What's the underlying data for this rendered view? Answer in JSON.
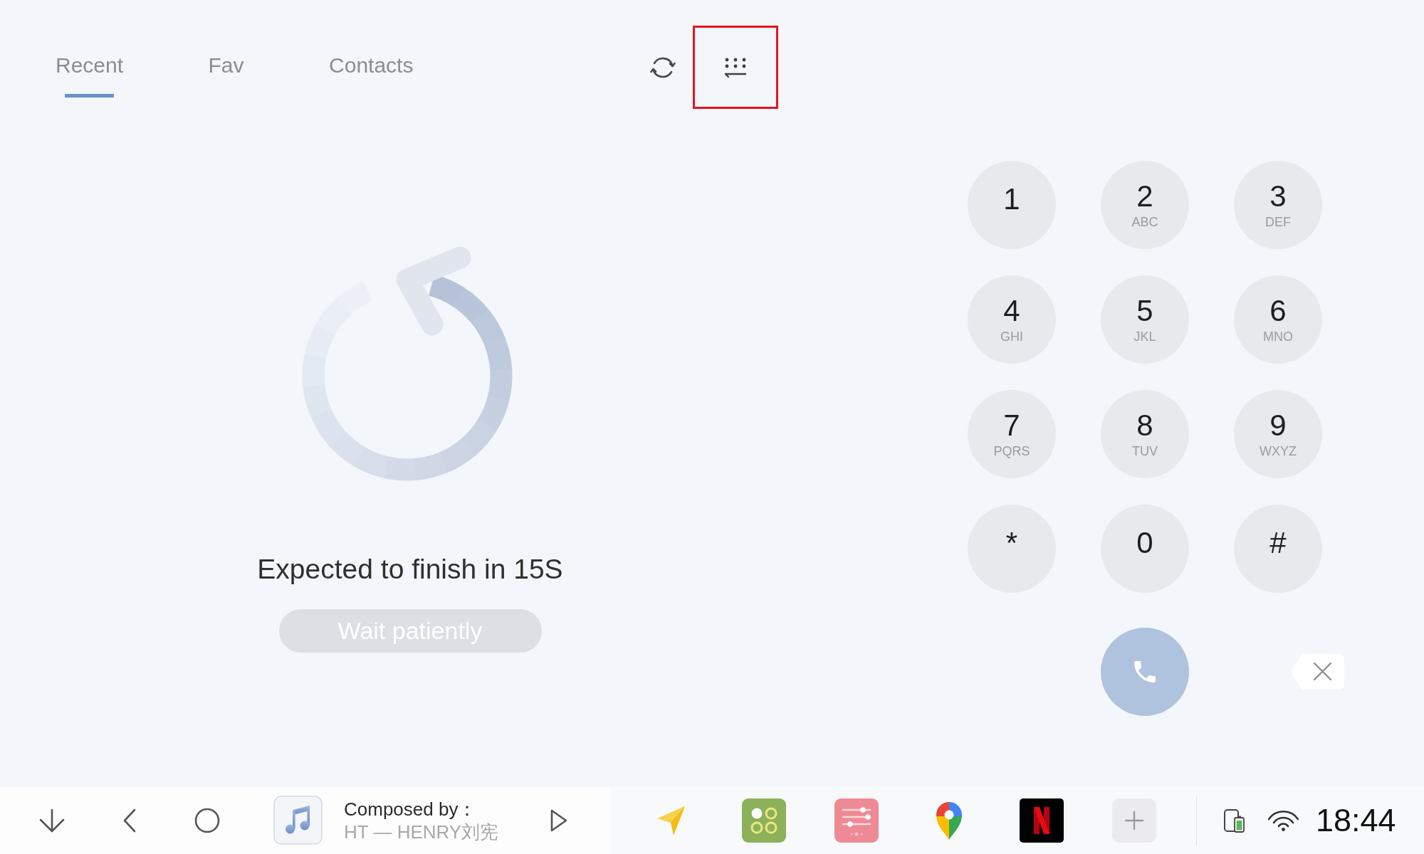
{
  "tabs": [
    {
      "label": "Recent",
      "selected": true
    },
    {
      "label": "Fav",
      "selected": false
    },
    {
      "label": "Contacts",
      "selected": false
    }
  ],
  "keypad_toggle": {
    "highlighted": true
  },
  "progress": {
    "message": "Expected to finish in 15S",
    "button": {
      "label": "Wait patiently",
      "disabled": true
    }
  },
  "dialpad": {
    "keys": [
      {
        "digit": "1"
      },
      {
        "digit": "2",
        "letters": "ABC"
      },
      {
        "digit": "3",
        "letters": "DEF"
      },
      {
        "digit": "4",
        "letters": "GHI"
      },
      {
        "digit": "5",
        "letters": "JKL"
      },
      {
        "digit": "6",
        "letters": "MNO"
      },
      {
        "digit": "7",
        "letters": "PQRS"
      },
      {
        "digit": "8",
        "letters": "TUV"
      },
      {
        "digit": "9",
        "letters": "WXYZ"
      },
      {
        "digit": "*"
      },
      {
        "digit": "0"
      },
      {
        "digit": "#"
      }
    ],
    "call_button": {
      "disabled": true
    }
  },
  "taskbar": {
    "media": {
      "title": "Composed by：",
      "subtitle": "HT — HENRY刘宪"
    },
    "apps": [
      {
        "kind": "navigation"
      },
      {
        "kind": "circles"
      },
      {
        "kind": "sliders"
      },
      {
        "kind": "pin"
      },
      {
        "kind": "video"
      },
      {
        "kind": "add"
      }
    ],
    "clock": "18:44"
  }
}
